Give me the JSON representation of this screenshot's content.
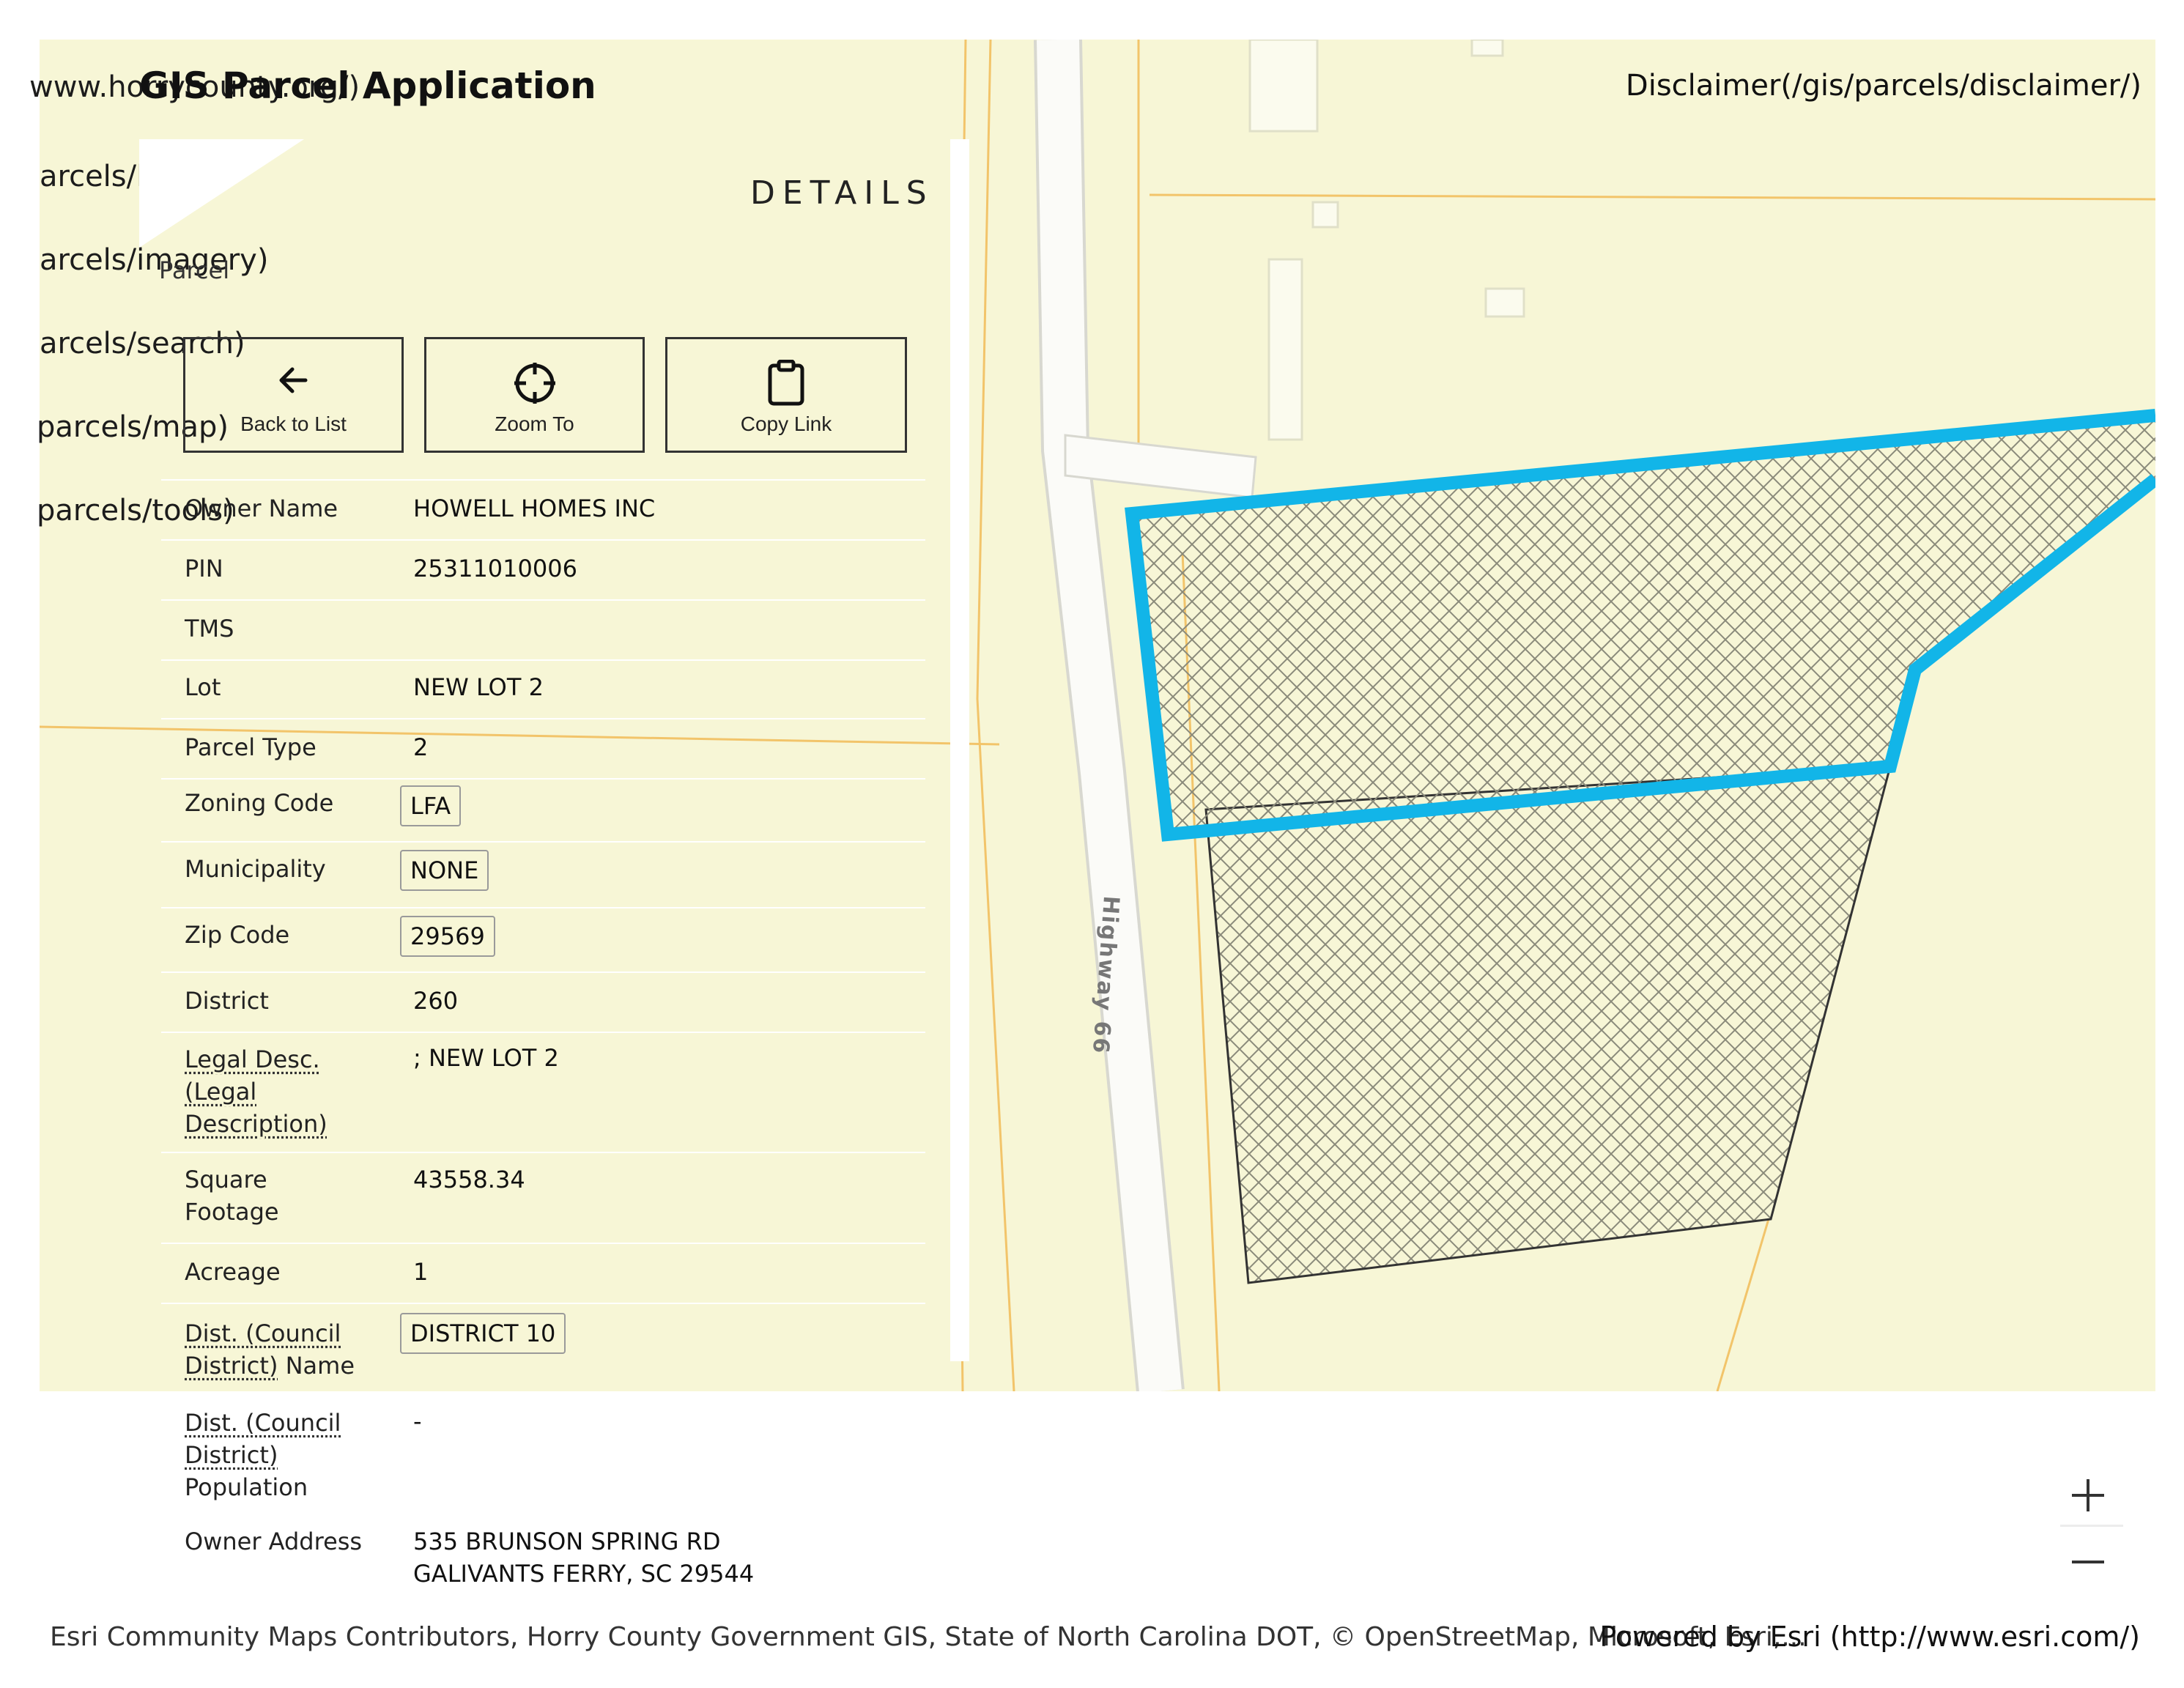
{
  "header": {
    "title": "GIS Parcel Application",
    "disclaimer_link": "Disclaimer(/gis/parcels/disclaimer/)"
  },
  "nav_url_fragments": [
    "www.horrycounty.org/)",
    "arcels/l",
    "arcels/imagery)",
    "arcels/search)",
    "parcels/map)",
    "parcels/tools)"
  ],
  "panel": {
    "heading": "DETAILS",
    "subheading": "Parcel",
    "actions": [
      {
        "label": "Back to List",
        "icon": "arrow-left-icon"
      },
      {
        "label": "Zoom To",
        "icon": "crosshair-icon"
      },
      {
        "label": "Copy Link",
        "icon": "clipboard-icon"
      }
    ],
    "attributes": [
      {
        "key": "Owner Name",
        "value": "HOWELL HOMES INC"
      },
      {
        "key": "PIN",
        "value": "25311010006"
      },
      {
        "key": "TMS",
        "value": ""
      },
      {
        "key": "Lot",
        "value": "NEW LOT 2"
      },
      {
        "key": "Parcel Type",
        "value": "2"
      },
      {
        "key": "Zoning Code",
        "value": "LFA"
      },
      {
        "key": "Municipality",
        "value": "NONE"
      },
      {
        "key": "Zip Code",
        "value": "29569"
      },
      {
        "key": "District",
        "value": "260"
      },
      {
        "key_abbr": "Legal Desc. (Legal Description)",
        "value": "; NEW LOT 2"
      },
      {
        "key_line1": "Square",
        "key_line2": "Footage",
        "value": "43558.34"
      },
      {
        "key": "Acreage",
        "value": "1"
      },
      {
        "key_abbr1": "Dist. (Council",
        "key_abbr2": "District)",
        "key_suffix": " Name",
        "value": "DISTRICT 10"
      },
      {
        "key_abbr1": "Dist. (Council",
        "key_abbr2": "District)",
        "key_suffix": "Population",
        "value": "-"
      },
      {
        "key": "Owner Address",
        "value_line1": "535 BRUNSON SPRING RD",
        "value_line2": "GALIVANTS FERRY, SC 29544"
      }
    ]
  },
  "map": {
    "road_label": "Highway 66",
    "selection_color": "#12b5e8",
    "map_background": "#f7f6d6"
  },
  "zoom": {
    "in_label": "+",
    "out_label": "–"
  },
  "footer": {
    "attribution": "Esri Community Maps Contributors, Horry County Government GIS, State of North Carolina DOT, © OpenStreetMap, Microsoft, Esri,...",
    "attribution_overlay": "Comp Label",
    "powered_by": "Powered by Esri (http://www.esri.com/)"
  }
}
